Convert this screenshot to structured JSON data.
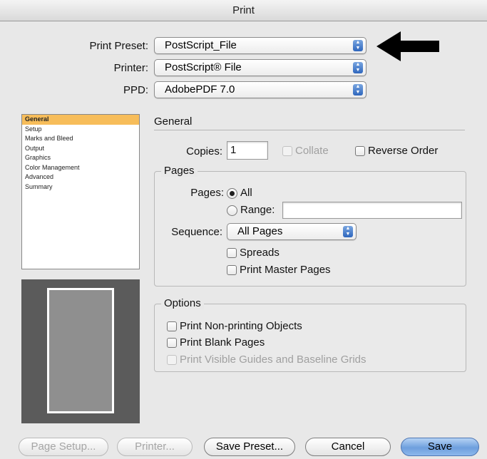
{
  "window": {
    "title": "Print"
  },
  "preset": {
    "label": "Print Preset:",
    "value": "PostScript_File"
  },
  "printer": {
    "label": "Printer:",
    "value": "PostScript® File"
  },
  "ppd": {
    "label": "PPD:",
    "value": "AdobePDF 7.0"
  },
  "sidebar": {
    "items": [
      {
        "label": "General",
        "selected": true
      },
      {
        "label": "Setup"
      },
      {
        "label": "Marks and Bleed"
      },
      {
        "label": "Output"
      },
      {
        "label": "Graphics"
      },
      {
        "label": "Color Management"
      },
      {
        "label": "Advanced"
      },
      {
        "label": "Summary"
      }
    ]
  },
  "general": {
    "title": "General",
    "copies_label": "Copies:",
    "copies_value": "1",
    "collate_label": "Collate",
    "reverse_order_label": "Reverse Order"
  },
  "pages": {
    "title": "Pages",
    "pages_label": "Pages:",
    "all_label": "All",
    "range_label": "Range:",
    "range_value": "",
    "sequence_label": "Sequence:",
    "sequence_value": "All Pages",
    "spreads_label": "Spreads",
    "master_pages_label": "Print Master Pages"
  },
  "options": {
    "title": "Options",
    "non_printing_label": "Print Non-printing Objects",
    "blank_pages_label": "Print Blank Pages",
    "guides_label": "Print Visible Guides and Baseline Grids"
  },
  "buttons": {
    "page_setup": "Page Setup...",
    "printer": "Printer...",
    "save_preset": "Save Preset...",
    "cancel": "Cancel",
    "save": "Save"
  },
  "colors": {
    "selection": "#f7bd5a",
    "default_button": "#6e9fdd"
  }
}
